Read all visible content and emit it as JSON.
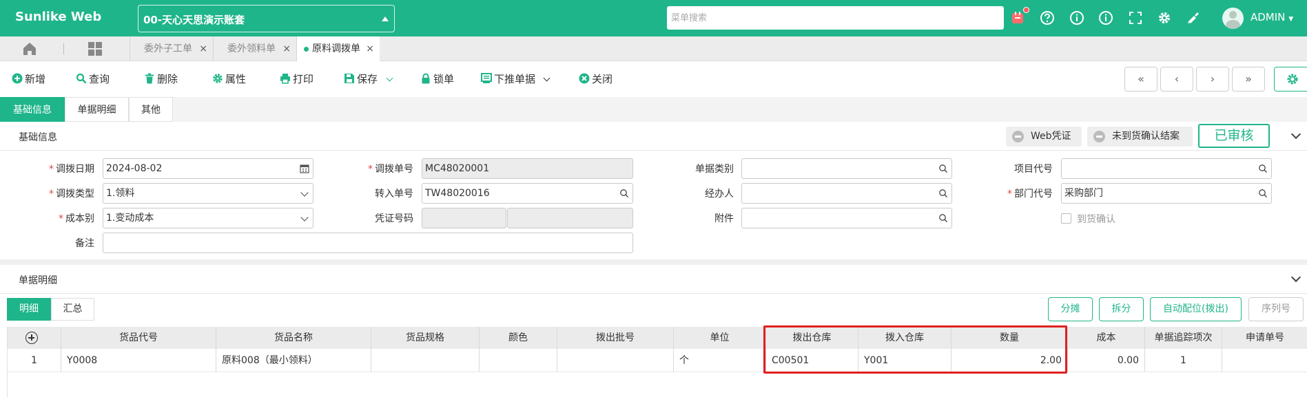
{
  "app": {
    "logo": "Sunlike Web",
    "account": "00-天心天思演示账套",
    "search_placeholder": "菜单搜索",
    "user": "ADMIN",
    "user_caret": "▼"
  },
  "tabs": [
    {
      "label": "委外子工单",
      "close": "×"
    },
    {
      "label": "委外领料单",
      "close": "×"
    },
    {
      "label": "原料调拨单",
      "close": "×"
    }
  ],
  "toolbar": {
    "add": "新增",
    "query": "查询",
    "delete": "删除",
    "props": "属性",
    "print": "打印",
    "save": "保存",
    "lock": "锁单",
    "push": "下推单据",
    "close": "关闭",
    "nav_first": "«",
    "nav_prev": "‹",
    "nav_next": "›",
    "nav_last": "»"
  },
  "section_tabs": [
    "基础信息",
    "单据明细",
    "其他"
  ],
  "basic": {
    "title": "基础信息",
    "web_voucher": "Web凭证",
    "unconfirmed": "未到货确认结案",
    "status": "已审核"
  },
  "form": {
    "date": {
      "label": "调拨日期",
      "value": "2024-08-02",
      "required": "*"
    },
    "doc_no": {
      "label": "调拨单号",
      "value": "MC48020001",
      "required": "*"
    },
    "doc_cat": {
      "label": "单据类别",
      "value": ""
    },
    "project": {
      "label": "项目代号",
      "value": ""
    },
    "type": {
      "label": "调拨类型",
      "value": "1.领料",
      "required": "*"
    },
    "in_no": {
      "label": "转入单号",
      "value": "TW48020016"
    },
    "handler": {
      "label": "经办人",
      "value": ""
    },
    "dept": {
      "label": "部门代号",
      "value": "采购部门",
      "required": "*"
    },
    "cost": {
      "label": "成本别",
      "value": "1.变动成本",
      "required": "*"
    },
    "voucher": {
      "label": "凭证号码",
      "value": ""
    },
    "attach": {
      "label": "附件",
      "value": ""
    },
    "arrival": {
      "label": "到货确认"
    },
    "remark": {
      "label": "备注",
      "value": ""
    }
  },
  "detail": {
    "title": "单据明细",
    "tabs": [
      "明细",
      "汇总"
    ],
    "btn_share": "分摊",
    "btn_split": "拆分",
    "btn_auto": "自动配位(拨出)",
    "btn_serial": "序列号"
  },
  "grid": {
    "headers": [
      "货品代号",
      "货品名称",
      "货品规格",
      "颜色",
      "拨出批号",
      "单位",
      "拨出仓库",
      "拨入仓库",
      "数量",
      "成本",
      "单据追踪项次",
      "申请单号"
    ],
    "rows": [
      {
        "idx": "1",
        "code": "Y0008",
        "name": "原料008（最小领料）",
        "spec": "",
        "color": "",
        "batch": "",
        "unit": "个",
        "out_wh": "C00501",
        "in_wh": "Y001",
        "qty": "2.00",
        "cost": "0.00",
        "trace": "1",
        "apply": ""
      }
    ]
  },
  "colors": {
    "accent": "#1fb58a",
    "highlight": "#e02020"
  }
}
